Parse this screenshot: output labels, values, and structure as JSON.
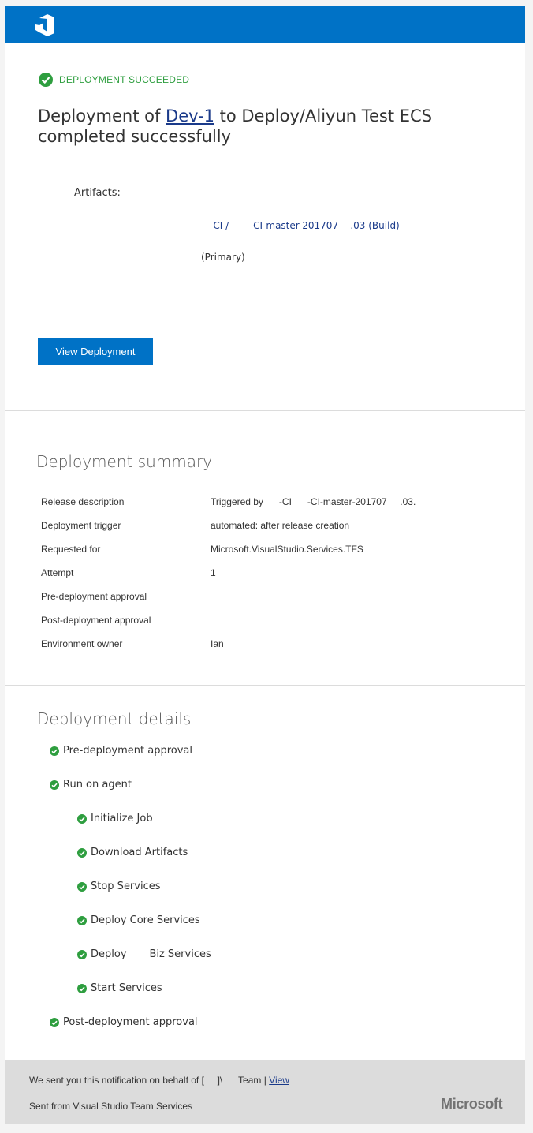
{
  "header": {
    "logo_icon": "visual-studio-icon",
    "color": "#0072c6"
  },
  "status": {
    "label": "DEPLOYMENT SUCCEEDED",
    "color": "#2e9e3f"
  },
  "title": {
    "prefix": "Deployment of ",
    "release_link": "Dev-1",
    "suffix": " to Deploy/Aliyun Test ECS completed successfully"
  },
  "artifacts": {
    "label": "Artifacts:",
    "build_link": "-CI /       -CI-master-201707    .03",
    "build_type_link": "(Build)",
    "primary": "(Primary)"
  },
  "view_button": "View Deployment",
  "summary": {
    "title": "Deployment summary",
    "rows": [
      {
        "label": "Release description",
        "value": "Triggered by      -CI      -CI-master-201707     .03."
      },
      {
        "label": "Deployment trigger",
        "value": "automated: after release creation"
      },
      {
        "label": "Requested for",
        "value": "Microsoft.VisualStudio.Services.TFS"
      },
      {
        "label": "Attempt",
        "value": "1"
      },
      {
        "label": "Pre-deployment approval",
        "value": ""
      },
      {
        "label": "Post-deployment approval",
        "value": ""
      },
      {
        "label": "Environment owner",
        "value": "Ian"
      }
    ]
  },
  "details": {
    "title": "Deployment details",
    "steps": [
      {
        "label": "Pre-deployment approval",
        "status": "succeeded"
      },
      {
        "label": "Run on agent",
        "status": "succeeded"
      },
      {
        "label": "Initialize Job",
        "status": "succeeded"
      },
      {
        "label": "Download Artifacts",
        "status": "succeeded"
      },
      {
        "label": "Stop Services",
        "status": "succeeded"
      },
      {
        "label": "Deploy Core Services",
        "status": "succeeded"
      },
      {
        "label": "Deploy       Biz Services",
        "status": "succeeded"
      },
      {
        "label": "Start Services",
        "status": "succeeded"
      },
      {
        "label": "Post-deployment approval",
        "status": "succeeded"
      }
    ]
  },
  "footer": {
    "notice_prefix": "We sent you this notification on behalf of [     ]\\      Team | ",
    "view_link": "View",
    "sent_from": "Sent from Visual Studio Team Services",
    "brand": "Microsoft"
  }
}
